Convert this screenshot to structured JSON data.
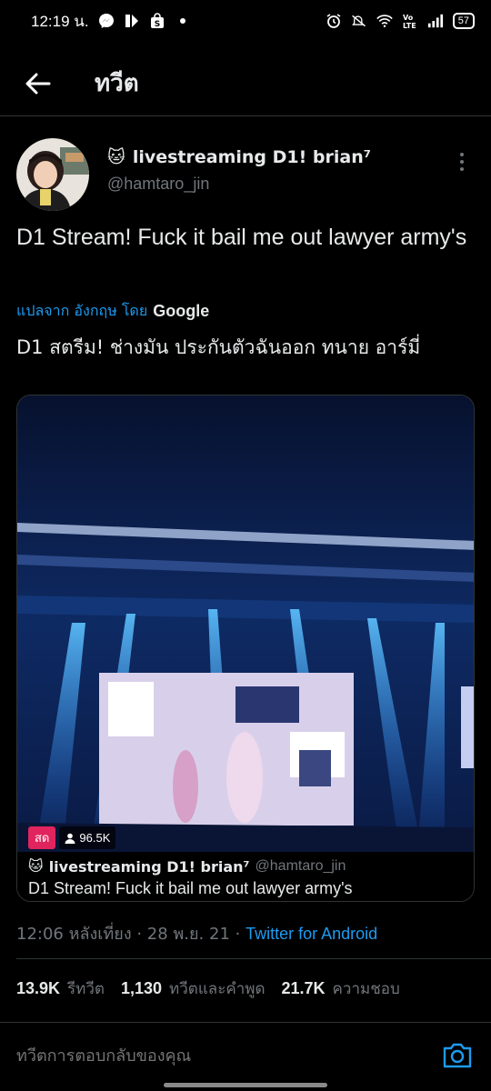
{
  "status_bar": {
    "time": "12:19 น.",
    "battery": "57"
  },
  "header": {
    "title": "ทวีต"
  },
  "tweet": {
    "emoji": "🐱",
    "display_name": "livestreaming D1! brian⁷",
    "handle": "@hamtaro_jin",
    "text": "D1 Stream! Fuck it bail me out lawyer army's",
    "translated_from": "แปลจาก อังกฤษ โดย",
    "translator": "Google",
    "translated_text": "D1 สตรีม! ช่างมัน ประกันตัวฉันออก ทนาย อาร์มี่",
    "timestamp": "12:06 หลังเที่ยง · 28 พ.ย. 21 · ",
    "source": "Twitter for Android"
  },
  "media_card": {
    "live_label": "สด",
    "viewers": "96.5K",
    "author_name": "livestreaming D1! brian⁷",
    "author_handle": "@hamtaro_jin",
    "text": "D1 Stream! Fuck it bail me out lawyer army's"
  },
  "stats": [
    {
      "count": "13.9K",
      "label": "รีทวีต"
    },
    {
      "count": "1,130",
      "label": "ทวีตและคำพูด"
    },
    {
      "count": "21.7K",
      "label": "ความชอบ"
    }
  ],
  "reply": {
    "placeholder": "ทวีตการตอบกลับของคุณ"
  },
  "colors": {
    "accent": "#1d9bf0",
    "live": "#e0245e",
    "muted": "#71767b"
  }
}
